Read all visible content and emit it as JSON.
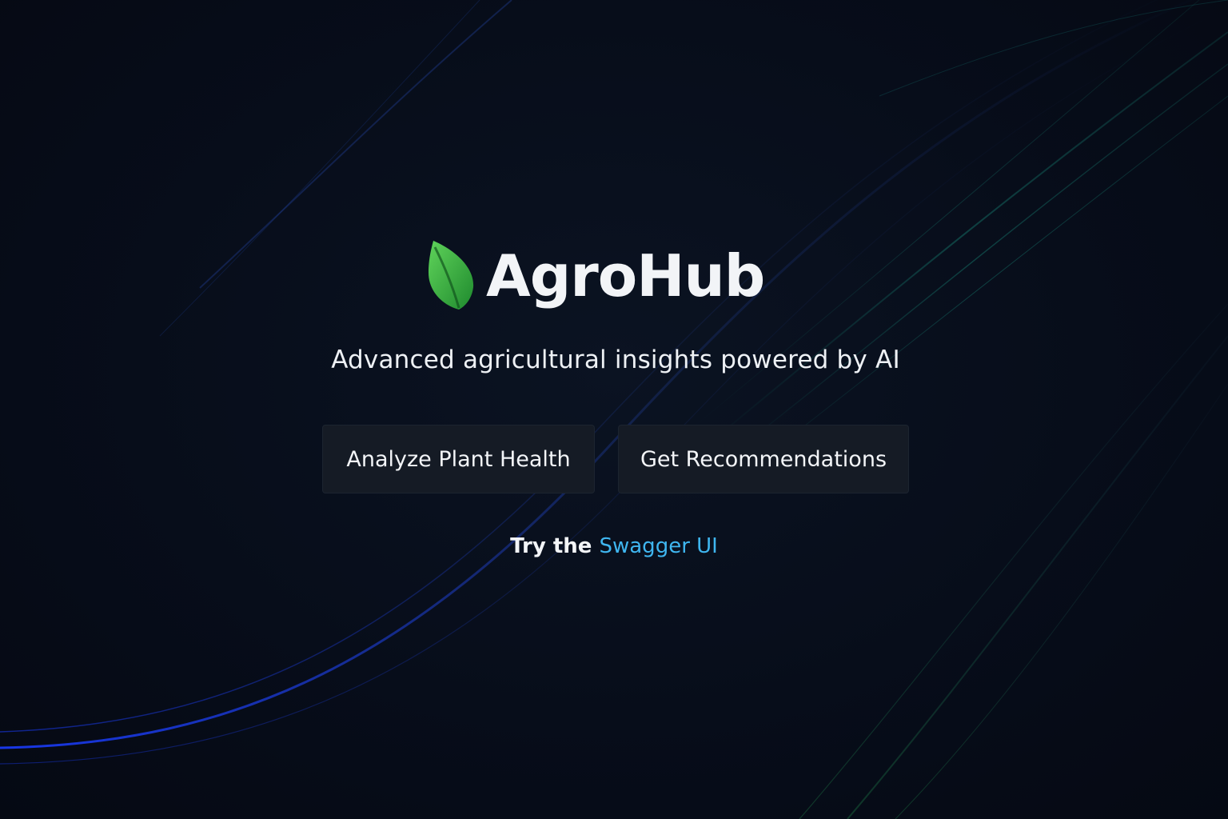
{
  "brand": {
    "name": "AgroHub",
    "logo_icon": "leaf-icon",
    "logo_color": "#3fa83a"
  },
  "hero": {
    "tagline": "Advanced agricultural insights powered by AI"
  },
  "actions": {
    "analyze_label": "Analyze Plant Health",
    "recommend_label": "Get Recommendations"
  },
  "footer_link": {
    "prefix": "Try the",
    "link_label": "Swagger UI",
    "link_color": "#3fb6f0"
  },
  "theme": {
    "background": "#060c18",
    "button_bg": "#151b25",
    "text": "#f2f4f7"
  }
}
